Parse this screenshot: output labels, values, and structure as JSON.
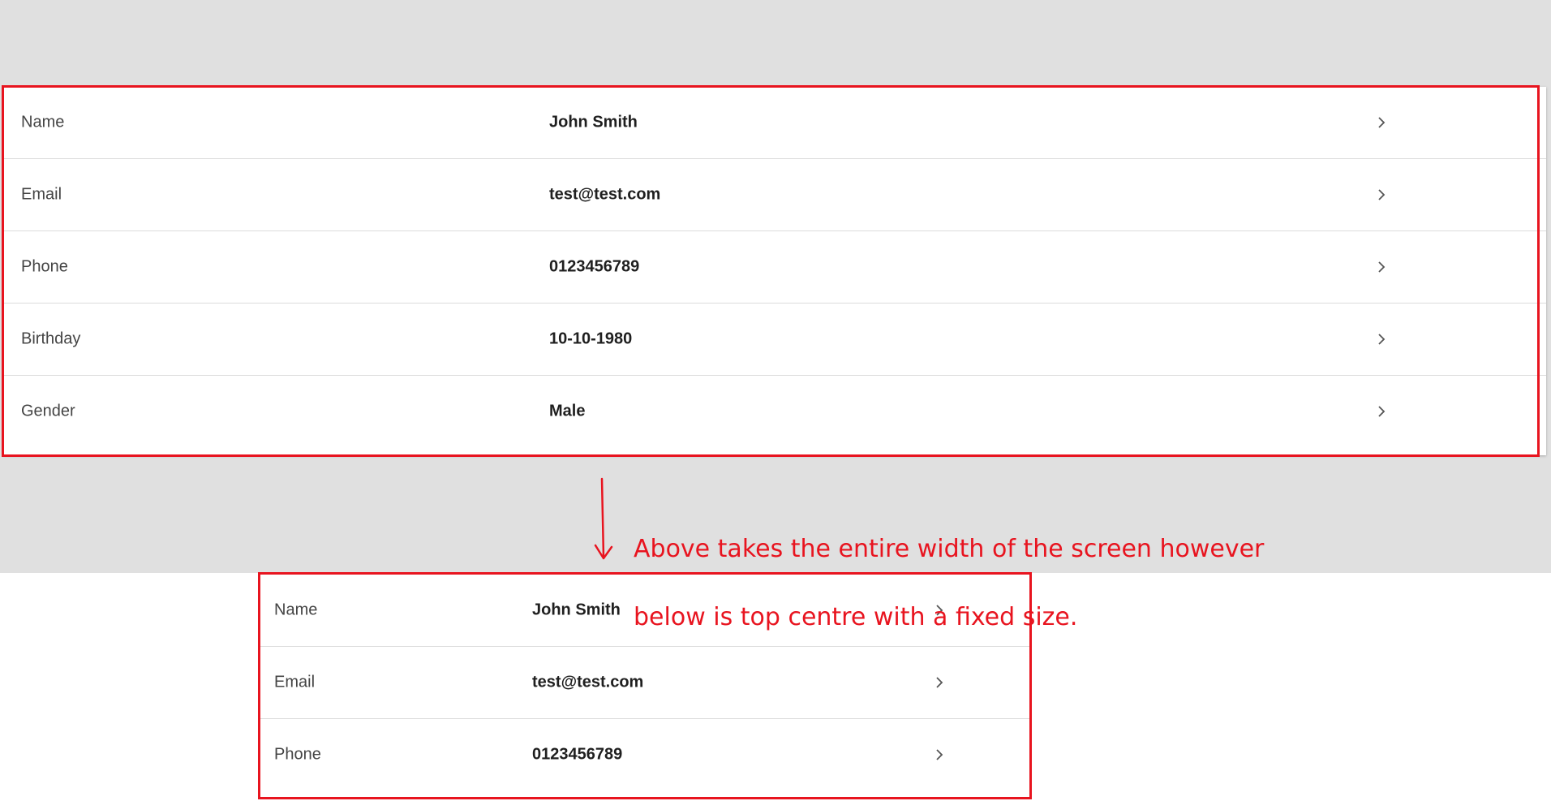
{
  "wide_card": {
    "rows": [
      {
        "label": "Name",
        "value": "John Smith"
      },
      {
        "label": "Email",
        "value": "test@test.com"
      },
      {
        "label": "Phone",
        "value": "0123456789"
      },
      {
        "label": "Birthday",
        "value": "10-10-1980"
      },
      {
        "label": "Gender",
        "value": "Male"
      }
    ]
  },
  "narrow_card": {
    "rows": [
      {
        "label": "Name",
        "value": "John Smith"
      },
      {
        "label": "Email",
        "value": "test@test.com"
      },
      {
        "label": "Phone",
        "value": "0123456789"
      }
    ]
  },
  "annotation": {
    "line1": "Above takes the entire width of the screen however",
    "line2": "below is top centre with a fixed size."
  },
  "icons": {
    "row_chevron": "chevron-right-icon"
  },
  "colors": {
    "annotation": "#e8141f",
    "top_background": "#e0e0e0",
    "card_background": "#ffffff",
    "divider": "#dcdcdc"
  }
}
